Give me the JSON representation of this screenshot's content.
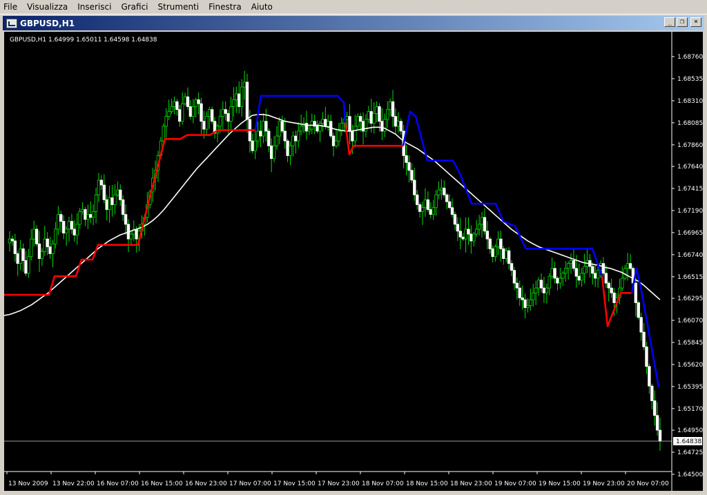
{
  "menu": [
    "File",
    "Visualizza",
    "Inserisci",
    "Grafici",
    "Strumenti",
    "Finestra",
    "Aiuto"
  ],
  "window": {
    "title": "GBPUSD,H1",
    "buttons": {
      "minimize": "_",
      "restore": "❐",
      "close": "×"
    }
  },
  "chart_info": "GBPUSD,H1  1.64999 1.65011 1.64598 1.64838",
  "current_price_label": "1.64838",
  "chart_data": {
    "type": "candlestick",
    "symbol": "GBPUSD",
    "timeframe": "H1",
    "ohlc_header": {
      "open": 1.64999,
      "high": 1.65011,
      "low": 1.64598,
      "close": 1.64838
    },
    "current_price": 1.64838,
    "ylim": [
      1.645,
      1.6876
    ],
    "price_ticks": [
      "1.68760",
      "1.68535",
      "1.68310",
      "1.68085",
      "1.67860",
      "1.67640",
      "1.67415",
      "1.67190",
      "1.66965",
      "1.66740",
      "1.66515",
      "1.66295",
      "1.66070",
      "1.65845",
      "1.65620",
      "1.65395",
      "1.65170",
      "1.64950",
      "1.64725",
      "1.64500"
    ],
    "time_ticks": [
      "13 Nov 2009",
      "13 Nov 22:00",
      "16 Nov 07:00",
      "16 Nov 15:00",
      "16 Nov 23:00",
      "17 Nov 07:00",
      "17 Nov 15:00",
      "17 Nov 23:00",
      "18 Nov 07:00",
      "18 Nov 15:00",
      "18 Nov 23:00",
      "19 Nov 07:00",
      "19 Nov 15:00",
      "19 Nov 23:00",
      "20 Nov 07:00"
    ],
    "closes": [
      1.669,
      1.6688,
      1.6675,
      1.6665,
      1.668,
      1.6668,
      1.6655,
      1.6672,
      1.669,
      1.67,
      1.6685,
      1.667,
      1.6677,
      1.669,
      1.6682,
      1.6675,
      1.6685,
      1.67,
      1.6715,
      1.6708,
      1.6696,
      1.67,
      1.6708,
      1.67,
      1.6694,
      1.6705,
      1.6718,
      1.672,
      1.671,
      1.6715,
      1.6712,
      1.6718,
      1.6735,
      1.675,
      1.6745,
      1.673,
      1.672,
      1.6732,
      1.6725,
      1.6735,
      1.674,
      1.673,
      1.6715,
      1.6705,
      1.669,
      1.6695,
      1.67,
      1.669,
      1.6698,
      1.6705,
      1.6712,
      1.6725,
      1.6738,
      1.6752,
      1.676,
      1.6775,
      1.679,
      1.6805,
      1.6815,
      1.682,
      1.6825,
      1.683,
      1.6822,
      1.681,
      1.6828,
      1.6835,
      1.6825,
      1.6815,
      1.6825,
      1.6832,
      1.6828,
      1.681,
      1.6802,
      1.6815,
      1.6822,
      1.681,
      1.6798,
      1.6805,
      1.6815,
      1.6822,
      1.6818,
      1.681,
      1.6825,
      1.6832,
      1.6838,
      1.6825,
      1.6845,
      1.685,
      1.6812,
      1.679,
      1.678,
      1.679,
      1.68,
      1.6795,
      1.681,
      1.68,
      1.6785,
      1.6772,
      1.6785,
      1.6795,
      1.681,
      1.68,
      1.679,
      1.6775,
      1.6785,
      1.6795,
      1.679,
      1.68,
      1.6805,
      1.6808,
      1.68,
      1.6802,
      1.681,
      1.6805,
      1.68,
      1.6808,
      1.6812,
      1.6805,
      1.681,
      1.6795,
      1.6785,
      1.679,
      1.68,
      1.6808,
      1.6812,
      1.6815,
      1.68,
      1.679,
      1.6805,
      1.6815,
      1.681,
      1.68,
      1.6812,
      1.682,
      1.6808,
      1.6818,
      1.6825,
      1.681,
      1.68,
      1.6812,
      1.6822,
      1.683,
      1.6815,
      1.6805,
      1.681,
      1.68,
      1.6775,
      1.6768,
      1.676,
      1.675,
      1.6735,
      1.6725,
      1.6718,
      1.6722,
      1.673,
      1.672,
      1.6715,
      1.6722,
      1.6735,
      1.674,
      1.6742,
      1.6735,
      1.6728,
      1.6722,
      1.6715,
      1.6705,
      1.6698,
      1.6692,
      1.669,
      1.67,
      1.6695,
      1.6688,
      1.6695,
      1.67,
      1.6705,
      1.6712,
      1.6698,
      1.669,
      1.668,
      1.6672,
      1.6682,
      1.669,
      1.668,
      1.667,
      1.6678,
      1.6665,
      1.6658,
      1.6645,
      1.664,
      1.663,
      1.6628,
      1.662,
      1.6622,
      1.6628,
      1.6635,
      1.664,
      1.6648,
      1.664,
      1.6635,
      1.664,
      1.6652,
      1.666,
      1.665,
      1.6645,
      1.665,
      1.6655,
      1.666,
      1.6665,
      1.6668,
      1.666,
      1.6652,
      1.6648,
      1.6655,
      1.6662,
      1.6668,
      1.6662,
      1.6655,
      1.665,
      1.6658,
      1.6665,
      1.6655,
      1.6645,
      1.664,
      1.6635,
      1.6625,
      1.663,
      1.664,
      1.665,
      1.666,
      1.6665,
      1.666,
      1.6645,
      1.6625,
      1.661,
      1.6595,
      1.658,
      1.656,
      1.654,
      1.6525,
      1.651,
      1.6495,
      1.6484
    ],
    "ma_white": [
      1.6612,
      1.6613,
      1.6615,
      1.6617,
      1.662,
      1.6623,
      1.6627,
      1.6631,
      1.6635,
      1.664,
      1.6645,
      1.665,
      1.6655,
      1.666,
      1.6665,
      1.667,
      1.6675,
      1.668,
      1.6684,
      1.6688,
      1.6691,
      1.6694,
      1.6696,
      1.6698,
      1.67,
      1.6702,
      1.6705,
      1.6709,
      1.6714,
      1.672,
      1.6727,
      1.6734,
      1.6741,
      1.6748,
      1.6755,
      1.6762,
      1.6768,
      1.6774,
      1.678,
      1.6786,
      1.6792,
      1.6798,
      1.6803,
      1.6808,
      1.6812,
      1.6816,
      1.6817,
      1.6817,
      1.6816,
      1.6814,
      1.6812,
      1.681,
      1.6809,
      1.6808,
      1.6807,
      1.6806,
      1.6806,
      1.6806,
      1.6805,
      1.6804,
      1.6802,
      1.6801,
      1.68,
      1.68,
      1.6801,
      1.6802,
      1.6803,
      1.6804,
      1.6804,
      1.6803,
      1.68,
      1.6797,
      1.6792,
      1.6788,
      1.6785,
      1.6782,
      1.6778,
      1.6774,
      1.677,
      1.6765,
      1.676,
      1.6755,
      1.675,
      1.6745,
      1.674,
      1.6735,
      1.673,
      1.6725,
      1.672,
      1.6715,
      1.671,
      1.6705,
      1.67,
      1.6696,
      1.6692,
      1.6688,
      1.6685,
      1.6682,
      1.668,
      1.6678,
      1.6676,
      1.6674,
      1.6672,
      1.667,
      1.6668,
      1.6666,
      1.6665,
      1.6664,
      1.6663,
      1.6661,
      1.666,
      1.6658,
      1.6656,
      1.6653,
      1.665,
      1.6647,
      1.6643,
      1.6638,
      1.6633,
      1.6628
    ],
    "red_line": [
      {
        "x": 0,
        "y": 1.6633
      },
      {
        "x": 65,
        "y": 1.6633
      },
      {
        "x": 73,
        "y": 1.6652
      },
      {
        "x": 104,
        "y": 1.6652
      },
      {
        "x": 112,
        "y": 1.6669
      },
      {
        "x": 128,
        "y": 1.6669
      },
      {
        "x": 136,
        "y": 1.6684
      },
      {
        "x": 194,
        "y": 1.6684
      },
      {
        "x": 210,
        "y": 1.673
      },
      {
        "x": 233,
        "y": 1.6792
      },
      {
        "x": 255,
        "y": 1.6792
      },
      {
        "x": 265,
        "y": 1.6796
      },
      {
        "x": 298,
        "y": 1.6796
      },
      {
        "x": 310,
        "y": 1.6801
      },
      {
        "x": 364,
        "y": 1.6801
      },
      {
        "x": 364,
        "y": null
      },
      {
        "x": 494,
        "y": 1.6809
      },
      {
        "x": 500,
        "y": 1.6776
      },
      {
        "x": 506,
        "y": 1.6785
      },
      {
        "x": 536,
        "y": 1.6785
      },
      {
        "x": 578,
        "y": 1.6785
      },
      {
        "x": 578,
        "y": null
      },
      {
        "x": 866,
        "y": 1.6652
      },
      {
        "x": 874,
        "y": 1.6601
      },
      {
        "x": 893,
        "y": 1.6635
      },
      {
        "x": 909,
        "y": 1.6635
      },
      {
        "x": 909,
        "y": null
      }
    ],
    "blue_line": [
      {
        "x": 364,
        "y": 1.6801
      },
      {
        "x": 372,
        "y": 1.6836
      },
      {
        "x": 483,
        "y": 1.6836
      },
      {
        "x": 492,
        "y": 1.6829
      },
      {
        "x": 494,
        "y": 1.6809
      },
      {
        "x": 494,
        "y": null
      },
      {
        "x": 578,
        "y": 1.6785
      },
      {
        "x": 588,
        "y": 1.682
      },
      {
        "x": 596,
        "y": 1.6815
      },
      {
        "x": 613,
        "y": 1.677
      },
      {
        "x": 650,
        "y": 1.677
      },
      {
        "x": 660,
        "y": 1.6757
      },
      {
        "x": 677,
        "y": 1.6726
      },
      {
        "x": 712,
        "y": 1.6726
      },
      {
        "x": 723,
        "y": 1.6708
      },
      {
        "x": 740,
        "y": 1.6703
      },
      {
        "x": 756,
        "y": 1.668
      },
      {
        "x": 852,
        "y": 1.668
      },
      {
        "x": 866,
        "y": 1.6652
      },
      {
        "x": 866,
        "y": null
      },
      {
        "x": 909,
        "y": 1.6635
      },
      {
        "x": 916,
        "y": 1.666
      },
      {
        "x": 923,
        "y": 1.6637
      },
      {
        "x": 948,
        "y": 1.6539
      }
    ]
  }
}
